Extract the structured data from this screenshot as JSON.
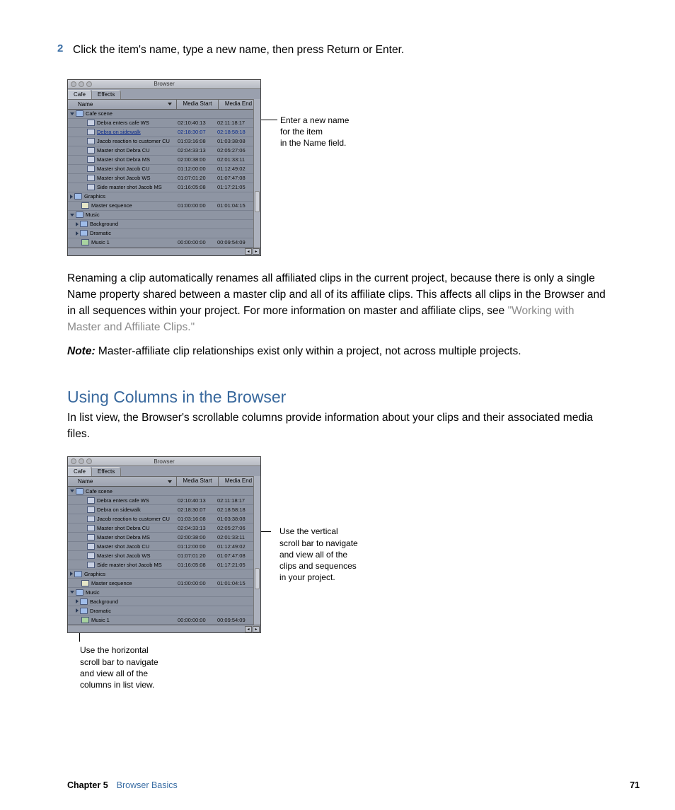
{
  "step": {
    "number": "2",
    "text": "Click the item's name, type a new name, then press Return or Enter."
  },
  "browser1": {
    "title": "Browser",
    "tabs": [
      "Cafe",
      "Effects"
    ],
    "columns": [
      "Name",
      "Media Start",
      "Media End"
    ],
    "callout": [
      "Enter a new name",
      "for the item",
      "in the Name field."
    ]
  },
  "rows": {
    "cafeScene": "Cafe scene",
    "debraEnters": {
      "name": "Debra enters cafe WS",
      "start": "02:10:40:13",
      "end": "02:11:18:17"
    },
    "debraSidewalk": {
      "name": "Debra on sidewalk",
      "start": "02:18:30:07",
      "end": "02:18:58:18"
    },
    "jacobReaction": {
      "name": "Jacob reaction to customer CU",
      "start": "01:03:16:08",
      "end": "01:03:38:08"
    },
    "masterDebraCU": {
      "name": "Master shot Debra CU",
      "start": "02:04:33:13",
      "end": "02:05:27:06"
    },
    "masterDebraMS": {
      "name": "Master shot Debra MS",
      "start": "02:00:38:00",
      "end": "02:01:33:11"
    },
    "masterJacobCU": {
      "name": "Master shot Jacob CU",
      "start": "01:12:00:00",
      "end": "01:12:49:02"
    },
    "masterJacobWS": {
      "name": "Master shot Jacob WS",
      "start": "01:07:01:20",
      "end": "01:07:47:08"
    },
    "sideMasterJacob": {
      "name": "Side master shot Jacob MS",
      "start": "01:16:05:08",
      "end": "01:17:21:05"
    },
    "graphics": "Graphics",
    "masterSeq": {
      "name": "Master sequence",
      "start": "01:00:00:00",
      "end": "01:01:04:15"
    },
    "music": "Music",
    "background": "Background",
    "dramatic": "Dramatic",
    "music1": {
      "name": "Music 1",
      "start": "00:00:00:00",
      "end": "00:09:54:09"
    }
  },
  "para1": {
    "text1": "Renaming a clip automatically renames all affiliated clips in the current project, because there is only a single Name property shared between a master clip and all of its affiliate clips. This affects all clips in the Browser and in all sequences within your project. For more information on master and affiliate clips, see ",
    "link": "\"Working with Master and Affiliate Clips.\""
  },
  "note": {
    "label": "Note:  ",
    "text": "Master-affiliate clip relationships exist only within a project, not across multiple projects."
  },
  "section": {
    "heading": "Using Columns in the Browser",
    "intro": "In list view, the Browser's scrollable columns provide information about your clips and their associated media files."
  },
  "callout_v": [
    "Use the vertical",
    "scroll bar to navigate",
    "and view all of the",
    "clips and sequences",
    "in your project."
  ],
  "callout_h": [
    "Use the horizontal",
    "scroll bar to navigate",
    "and view all of the",
    "columns in list view."
  ],
  "footer": {
    "chapter": "Chapter 5",
    "title": "Browser Basics",
    "page": "71"
  }
}
